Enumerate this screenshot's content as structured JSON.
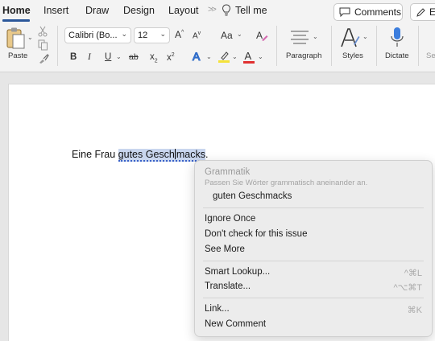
{
  "tabs": {
    "home": "Home",
    "insert": "Insert",
    "draw": "Draw",
    "design": "Design",
    "layout": "Layout",
    "overflow": ">>",
    "tell_me": "Tell me"
  },
  "top_buttons": {
    "comments": "Comments",
    "edit": "E"
  },
  "ribbon": {
    "paste": "Paste",
    "font_name": "Calibri (Bo...",
    "font_size": "12",
    "grow": "A",
    "shrink": "A",
    "case": "Aa",
    "bold": "B",
    "italic": "I",
    "underline": "U",
    "strike": "ab",
    "subscript": "x",
    "superscript": "x",
    "sub_mark": "2",
    "sup_mark": "2",
    "paragraph": "Paragraph",
    "styles": "Styles",
    "dictate": "Dictate",
    "sensitivity": "Se"
  },
  "document": {
    "before": "Eine Frau ",
    "err1": "gutes Gesch",
    "err2": "macks",
    "after": "."
  },
  "menu": {
    "header": "Grammatik",
    "sub": "Passen Sie Wörter grammatisch aneinander an.",
    "suggestion": "guten Geschmacks",
    "ignore": "Ignore Once",
    "dont_check": "Don't check for this issue",
    "see_more": "See More",
    "smart_lookup": "Smart Lookup...",
    "smart_lookup_sc": "^⌘L",
    "translate": "Translate...",
    "translate_sc": "^⌥⌘T",
    "link": "Link...",
    "link_sc": "⌘K",
    "new_comment": "New Comment"
  },
  "colors": {
    "accent": "#2b579a",
    "highlight": "#c9d6ee",
    "font_color": "#e03030",
    "highlighter": "#f4e23a"
  }
}
